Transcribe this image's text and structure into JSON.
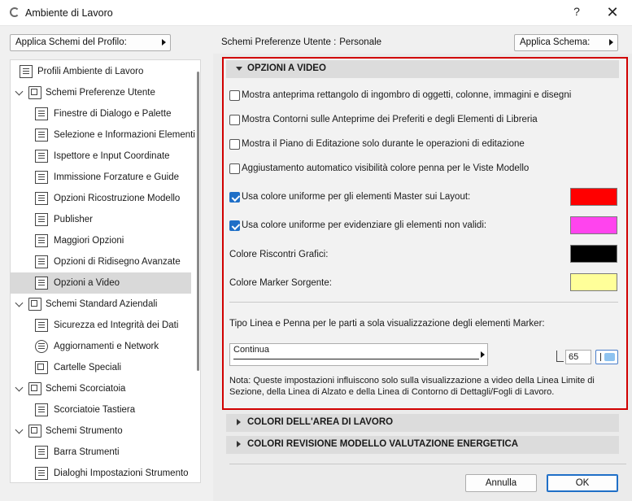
{
  "window": {
    "title": "Ambiente di Lavoro",
    "help": "?",
    "close": "✕"
  },
  "top": {
    "profile_button": "Applica Schemi del Profilo:",
    "schema_label": "Schemi Preferenze Utente :",
    "schema_value": "Personale",
    "apply_schema_button": "Applica Schema:"
  },
  "tree": {
    "items": [
      {
        "label": "Profili Ambiente di Lavoro"
      },
      {
        "label": "Schemi Preferenze Utente"
      },
      {
        "label": "Finestre di Dialogo e Palette"
      },
      {
        "label": "Selezione e Informazioni Elementi"
      },
      {
        "label": "Ispettore e Input Coordinate"
      },
      {
        "label": "Immissione Forzature e Guide"
      },
      {
        "label": "Opzioni Ricostruzione Modello"
      },
      {
        "label": "Publisher"
      },
      {
        "label": "Maggiori Opzioni"
      },
      {
        "label": "Opzioni di Ridisegno Avanzate"
      },
      {
        "label": "Opzioni a Video",
        "selected": true
      },
      {
        "label": "Schemi Standard Aziendali"
      },
      {
        "label": "Sicurezza ed Integrità dei Dati"
      },
      {
        "label": "Aggiornamenti e Network"
      },
      {
        "label": "Cartelle Speciali"
      },
      {
        "label": "Schemi Scorciatoia"
      },
      {
        "label": "Scorciatoie Tastiera"
      },
      {
        "label": "Schemi Strumento"
      },
      {
        "label": "Barra Strumenti"
      },
      {
        "label": "Dialoghi Impostazioni Strumento"
      }
    ]
  },
  "sections": {
    "video": "OPZIONI A VIDEO",
    "workarea": "COLORI DELL'AREA DI LAVORO",
    "energy": "COLORI REVISIONE MODELLO VALUTAZIONE ENERGETICA"
  },
  "options": {
    "opt1": "Mostra anteprima rettangolo di ingombro di oggetti, colonne, immagini e disegni",
    "opt2": "Mostra Contorni sulle Anteprime dei Preferiti e degli Elementi di Libreria",
    "opt3": "Mostra il Piano di Editazione solo durante le operazioni di editazione",
    "opt4": "Aggiustamento automatico visibilità colore penna per le Viste Modello",
    "opt5": "Usa colore uniforme per gli elementi Master sui Layout:",
    "opt6": "Usa colore uniforme per evidenziare gli elementi non validi:",
    "graphic_overrides": "Colore Riscontri Grafici:",
    "source_marker": "Colore Marker Sorgente:",
    "line_pen_label": "Tipo Linea e Penna per le parti a sola visualizzazione degli elementi Marker:",
    "line_type": "Continua",
    "pen_value": "65",
    "note": "Nota: Queste impostazioni influiscono solo sulla visualizzazione a video della Linea Limite di Sezione, della Linea di Alzato e della Linea di Contorno di Dettagli/Fogli di Lavoro."
  },
  "colors": {
    "master": "#ff0000",
    "invalid": "#ff44ee",
    "graphic_overrides": "#000000",
    "source_marker": "#ffff99",
    "highlight_frame": "#d10000"
  },
  "buttons": {
    "cancel": "Annulla",
    "ok": "OK"
  }
}
